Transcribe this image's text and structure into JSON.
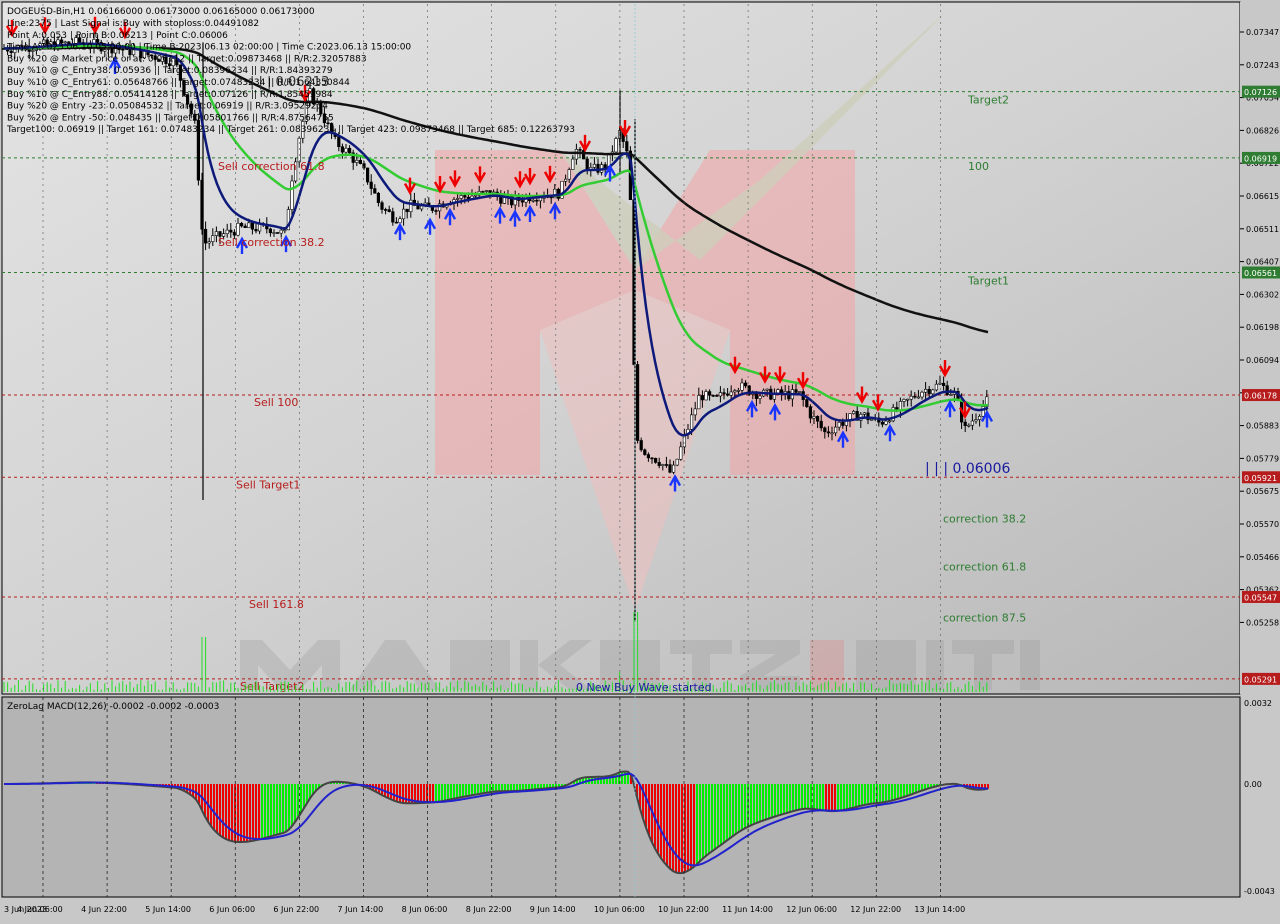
{
  "window": {
    "header": "DOGEUSD-Bin,H1  0.06166000 0.06173000 0.06165000 0.06173000"
  },
  "info_lines": [
    "Line:2375 | Last Signal is:Buy with stoploss:0.04491082",
    "Point A:0.053 | Point B:0.06213 | Point C:0.06006",
    "Time A:2023.06.10 05:00:00 | Time B:2023.06.13 02:00:00 | Time C:2023.06.13 15:00:00",
    "Buy %20 @ Market price or at: 0.06112 || Target:0.09873468 || R/R:2.32057883",
    "Buy %10 @ C_Entry38: 0.05936 || Target:0.08396234 || R/R:1.84393279",
    "Buy %10 @ C_Entry61: 0.05648766 || Target:0.07483234 || R/R:1.64350844",
    "Buy %10 @ C_Entry88: 0.05414128 || Target:0.07126 || R/R:1.85459984",
    "Buy %20 @ Entry -23: 0.05084532 || Target:0.06919 || R/R:3.09529234",
    "Buy %20 @ Entry -50: 0.048435 || Target:0.05801766 || R/R:4.87564765",
    "Target100: 0.06919 || Target 161: 0.07483234 || Target 261: 0.08396234 || Target 423: 0.09873468 || Target 685: 0.12263793"
  ],
  "overlay_labels": {
    "sell_correction_618": "Sell correction 61.8",
    "sell_correction_382": "Sell correction 38.2",
    "point_b_label": "| | | 0.06213",
    "point_c_label": "| | | 0.06006",
    "new_buy_wave": "0 New Buy Wave started"
  },
  "levels": [
    {
      "name": "Target2",
      "price": 0.07126,
      "side": "buy",
      "price_label": "0.07126"
    },
    {
      "name": "100",
      "price": 0.06919,
      "side": "buy",
      "price_label": "0.06919"
    },
    {
      "name": "Target1",
      "price": 0.06561,
      "side": "buy",
      "price_label": "0.06561"
    },
    {
      "name": "Sell 100",
      "price": 0.06178,
      "side": "sell",
      "price_label": "0.06178"
    },
    {
      "name": "Sell Target1",
      "price": 0.05921,
      "side": "sell",
      "price_label": "0.05921"
    },
    {
      "name": "correction 38.2",
      "price": 0.0578,
      "side": "corr",
      "price_label": ""
    },
    {
      "name": "correction 61.8",
      "price": 0.0563,
      "side": "corr",
      "price_label": ""
    },
    {
      "name": "Sell 161.8",
      "price": 0.05547,
      "side": "sell",
      "price_label": "0.05547"
    },
    {
      "name": "correction 87.5",
      "price": 0.0547,
      "side": "corr",
      "price_label": ""
    },
    {
      "name": "Sell Target2",
      "price": 0.05291,
      "side": "sell",
      "price_label": "0.05291"
    }
  ],
  "price_axis_ticks": [
    "0.07347",
    "0.07243",
    "0.07034",
    "0.06826",
    "0.06722",
    "0.06615",
    "0.06511",
    "0.06407",
    "0.06302",
    "0.06198",
    "0.06094",
    "0.05990",
    "0.05883",
    "0.05779",
    "0.05675",
    "0.05570",
    "0.05466",
    "0.05362",
    "0.05258"
  ],
  "time_axis_ticks": [
    "3 Jun 2023",
    "4 Jun 06:00",
    "4 Jun 22:00",
    "5 Jun 14:00",
    "6 Jun 06:00",
    "6 Jun 22:00",
    "7 Jun 14:00",
    "8 Jun 06:00",
    "8 Jun 22:00",
    "9 Jun 14:00",
    "10 Jun 06:00",
    "10 Jun 22:00",
    "11 Jun 14:00",
    "12 Jun 06:00",
    "12 Jun 22:00",
    "13 Jun 14:00"
  ],
  "macd": {
    "title": "ZeroLag MACD(12,26) -0.0002 -0.0002 -0.0003",
    "ticks": [
      "0.0032",
      "0.00",
      "-0.0043"
    ]
  },
  "colors": {
    "background": "#c8c8c8",
    "buy_level": "#2e7d32",
    "sell_level": "#b71c1c",
    "ma_fast": "#0d1a7a",
    "ma_mid": "#33cc33",
    "ma_slow": "#111111",
    "hist_up": "#00ee00",
    "hist_down": "#ee0000",
    "macd_line": "#2222cc",
    "signal_line": "#444444"
  },
  "chart_data": {
    "type": "candlestick",
    "symbol": "DOGEUSD-Bin",
    "timeframe": "H1",
    "ylim": [
      0.0525,
      0.074
    ],
    "last_price": 0.06173,
    "close_path": [
      [
        0,
        0.0726
      ],
      [
        40,
        0.0727
      ],
      [
        80,
        0.0728
      ],
      [
        120,
        0.0726
      ],
      [
        150,
        0.0724
      ],
      [
        175,
        0.0722
      ],
      [
        195,
        0.0702
      ],
      [
        203,
        0.0665
      ],
      [
        215,
        0.0667
      ],
      [
        240,
        0.067
      ],
      [
        270,
        0.067
      ],
      [
        285,
        0.0668
      ],
      [
        292,
        0.0686
      ],
      [
        300,
        0.07
      ],
      [
        310,
        0.0712
      ],
      [
        320,
        0.0707
      ],
      [
        335,
        0.0697
      ],
      [
        350,
        0.0693
      ],
      [
        365,
        0.0687
      ],
      [
        380,
        0.0677
      ],
      [
        395,
        0.0673
      ],
      [
        410,
        0.0677
      ],
      [
        430,
        0.0676
      ],
      [
        450,
        0.0679
      ],
      [
        470,
        0.068
      ],
      [
        490,
        0.0681
      ],
      [
        510,
        0.0678
      ],
      [
        530,
        0.068
      ],
      [
        560,
        0.0681
      ],
      [
        575,
        0.0695
      ],
      [
        590,
        0.0688
      ],
      [
        605,
        0.0689
      ],
      [
        620,
        0.07
      ],
      [
        628,
        0.0692
      ],
      [
        632,
        0.0669
      ],
      [
        635,
        0.0605
      ],
      [
        645,
        0.06
      ],
      [
        660,
        0.0597
      ],
      [
        672,
        0.0593
      ],
      [
        685,
        0.0605
      ],
      [
        700,
        0.0618
      ],
      [
        715,
        0.0616
      ],
      [
        735,
        0.0621
      ],
      [
        760,
        0.0618
      ],
      [
        780,
        0.0618
      ],
      [
        800,
        0.0618
      ],
      [
        810,
        0.0612
      ],
      [
        825,
        0.0606
      ],
      [
        840,
        0.0609
      ],
      [
        860,
        0.0612
      ],
      [
        880,
        0.0609
      ],
      [
        900,
        0.0614
      ],
      [
        920,
        0.0619
      ],
      [
        940,
        0.0621
      ],
      [
        955,
        0.0618
      ],
      [
        965,
        0.0607
      ],
      [
        975,
        0.0611
      ],
      [
        990,
        0.0617
      ]
    ]
  }
}
